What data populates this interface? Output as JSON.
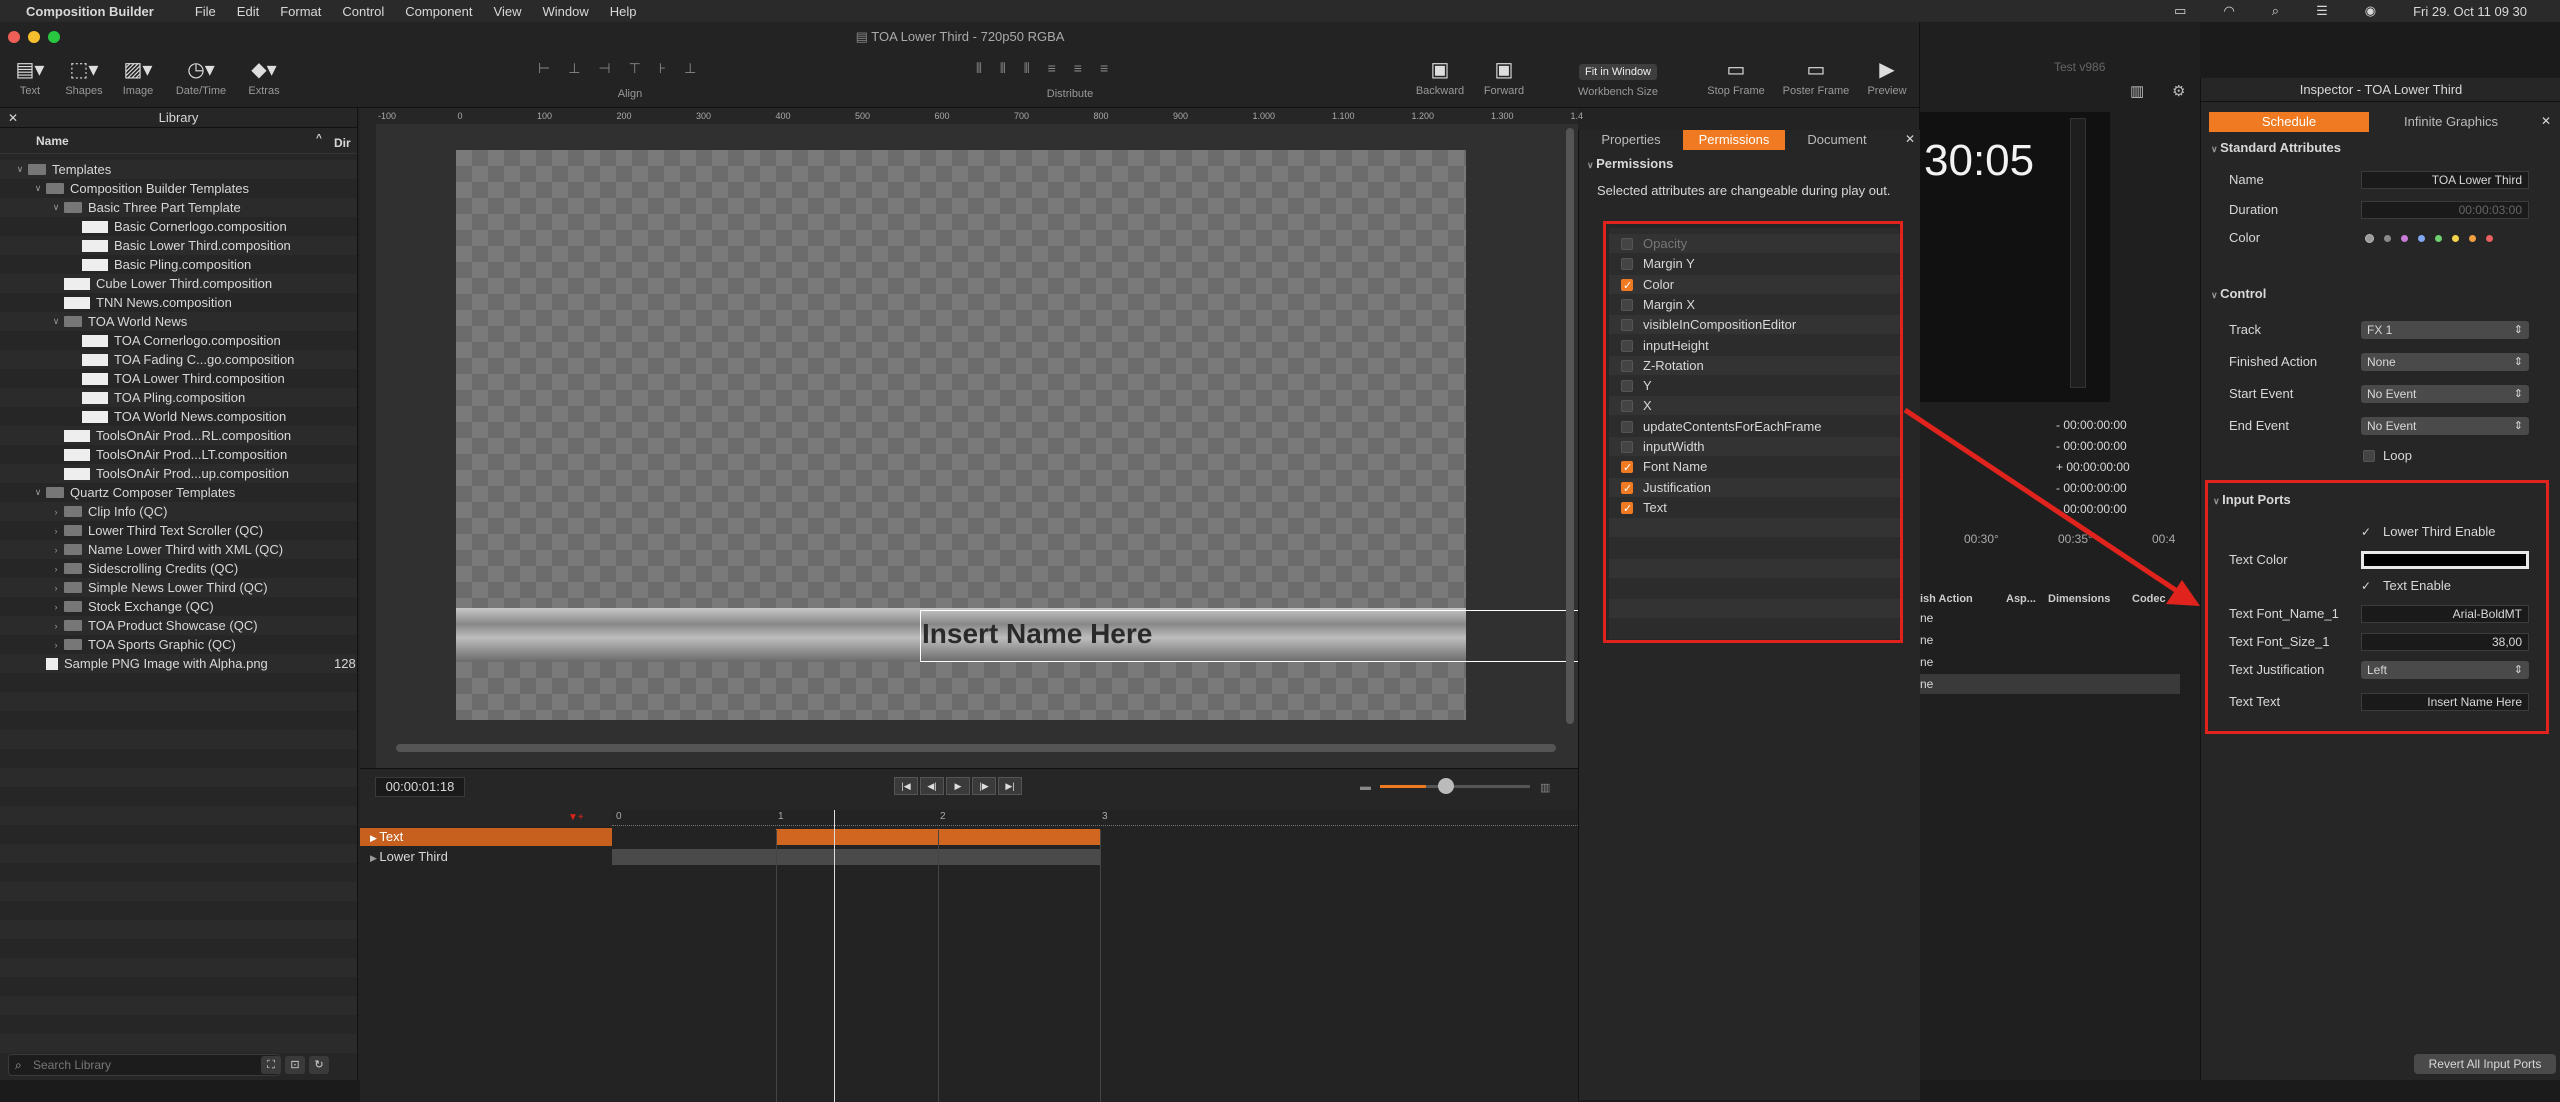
{
  "menubar": {
    "app": "Composition Builder",
    "items": [
      "File",
      "Edit",
      "Format",
      "Control",
      "Component",
      "View",
      "Window",
      "Help"
    ],
    "clock": "Fri 29. Oct  11 09 30"
  },
  "window": {
    "title": "TOA Lower Third - 720p50 RGBA"
  },
  "toolbar": {
    "text": "Text",
    "shapes": "Shapes",
    "image": "Image",
    "datetime": "Date/Time",
    "extras": "Extras",
    "align": "Align",
    "distribute": "Distribute",
    "backward": "Backward",
    "forward": "Forward",
    "workbench_value": "Fit in Window",
    "workbench_label": "Workbench Size",
    "stop_frame": "Stop Frame",
    "poster_frame": "Poster Frame",
    "preview": "Preview"
  },
  "library": {
    "title": "Library",
    "col_name": "Name",
    "col_dir": "Dir",
    "search_placeholder": "Search Library",
    "items": [
      {
        "label": "Templates",
        "depth": 0,
        "kind": "folder",
        "open": true
      },
      {
        "label": "Composition Builder Templates",
        "depth": 1,
        "kind": "folder",
        "open": true
      },
      {
        "label": "Basic Three Part Template",
        "depth": 2,
        "kind": "folder",
        "open": true
      },
      {
        "label": "Basic Cornerlogo.composition",
        "depth": 3,
        "kind": "file"
      },
      {
        "label": "Basic Lower Third.composition",
        "depth": 3,
        "kind": "file"
      },
      {
        "label": "Basic Pling.composition",
        "depth": 3,
        "kind": "file"
      },
      {
        "label": "Cube Lower Third.composition",
        "depth": 2,
        "kind": "file"
      },
      {
        "label": "TNN News.composition",
        "depth": 2,
        "kind": "file"
      },
      {
        "label": "TOA World News",
        "depth": 2,
        "kind": "folder",
        "open": true
      },
      {
        "label": "TOA Cornerlogo.composition",
        "depth": 3,
        "kind": "file"
      },
      {
        "label": "TOA Fading C...go.composition",
        "depth": 3,
        "kind": "file"
      },
      {
        "label": "TOA Lower Third.composition",
        "depth": 3,
        "kind": "file"
      },
      {
        "label": "TOA Pling.composition",
        "depth": 3,
        "kind": "file"
      },
      {
        "label": "TOA World News.composition",
        "depth": 3,
        "kind": "file"
      },
      {
        "label": "ToolsOnAir Prod...RL.composition",
        "depth": 2,
        "kind": "file"
      },
      {
        "label": "ToolsOnAir Prod...LT.composition",
        "depth": 2,
        "kind": "file"
      },
      {
        "label": "ToolsOnAir Prod...up.composition",
        "depth": 2,
        "kind": "file"
      },
      {
        "label": "Quartz Composer Templates",
        "depth": 1,
        "kind": "folder",
        "open": true
      },
      {
        "label": "Clip Info (QC)",
        "depth": 2,
        "kind": "folder"
      },
      {
        "label": "Lower Third Text Scroller (QC)",
        "depth": 2,
        "kind": "folder"
      },
      {
        "label": "Name Lower Third with XML (QC)",
        "depth": 2,
        "kind": "folder"
      },
      {
        "label": "Sidescrolling Credits (QC)",
        "depth": 2,
        "kind": "folder"
      },
      {
        "label": "Simple News Lower Third (QC)",
        "depth": 2,
        "kind": "folder"
      },
      {
        "label": "Stock Exchange (QC)",
        "depth": 2,
        "kind": "folder"
      },
      {
        "label": "TOA Product Showcase (QC)",
        "depth": 2,
        "kind": "folder"
      },
      {
        "label": "TOA Sports Graphic (QC)",
        "depth": 2,
        "kind": "folder"
      },
      {
        "label": "Sample PNG Image with Alpha.png",
        "depth": 1,
        "kind": "png",
        "extra": "128"
      }
    ]
  },
  "canvas": {
    "ruler": [
      "-100",
      "0",
      "100",
      "200",
      "300",
      "400",
      "500",
      "600",
      "700",
      "800",
      "900",
      "1.000",
      "1.100",
      "1.200",
      "1.300",
      "1.4"
    ],
    "name_text": "Insert Name Here"
  },
  "transport": {
    "timecode": "00:00:01:18"
  },
  "timeline": {
    "marks": [
      "0",
      "1",
      "2",
      "3"
    ],
    "tracks": [
      "Text",
      "Lower Third"
    ]
  },
  "right_panel": {
    "tabs": [
      "Properties",
      "Permissions",
      "Document"
    ],
    "section": "Permissions",
    "description": "Selected attributes are changeable during play out.",
    "attributes": [
      {
        "name": "Opacity",
        "checked": false,
        "disabled": true
      },
      {
        "name": "Margin Y",
        "checked": false
      },
      {
        "name": "Color",
        "checked": true
      },
      {
        "name": "Margin X",
        "checked": false
      },
      {
        "name": "visibleInCompositionEditor",
        "checked": false
      },
      {
        "name": "inputHeight",
        "checked": false
      },
      {
        "name": "Z-Rotation",
        "checked": false
      },
      {
        "name": "Y",
        "checked": false
      },
      {
        "name": "X",
        "checked": false
      },
      {
        "name": "updateContentsForEachFrame",
        "checked": false
      },
      {
        "name": "inputWidth",
        "checked": false
      },
      {
        "name": "Font Name",
        "checked": true
      },
      {
        "name": "Justification",
        "checked": true
      },
      {
        "name": "Text",
        "checked": true
      }
    ]
  },
  "background_app": {
    "title": "Test v986",
    "clock": "30:05",
    "timecodes": [
      "- 00:00:00:00",
      "- 00:00:00:00",
      "+ 00:00:00:00",
      "- 00:00:00:00",
      "- 00:00:00:00"
    ],
    "ruler": [
      "00:30°",
      "00:35°",
      "00:4"
    ],
    "cols": [
      "ish Action",
      "Asp...",
      "Dimensions",
      "Codec"
    ],
    "rows": [
      "ne",
      "ne",
      "ne",
      "ne"
    ]
  },
  "inspector": {
    "title": "Inspector - TOA Lower Third",
    "tabs": [
      "Schedule",
      "Infinite Graphics"
    ],
    "standard": "Standard Attributes",
    "name_label": "Name",
    "name_value": "TOA Lower Third",
    "duration_label": "Duration",
    "duration_value": "00:00:03:00",
    "color_label": "Color",
    "control": "Control",
    "track_label": "Track",
    "track_value": "FX 1",
    "finished_label": "Finished Action",
    "finished_value": "None",
    "start_label": "Start Event",
    "start_value": "No Event",
    "end_label": "End Event",
    "end_value": "No Event",
    "loop_label": "Loop",
    "ports": "Input Ports",
    "lower_enable": "Lower Third Enable",
    "text_color": "Text Color",
    "text_enable": "Text Enable",
    "font_name_label": "Text Font_Name_1",
    "font_name_value": "Arial-BoldMT",
    "font_size_label": "Text Font_Size_1",
    "font_size_value": "38,00",
    "justification_label": "Text Justification",
    "justification_value": "Left",
    "text_label": "Text Text",
    "text_value": "Insert Name Here",
    "revert": "Revert All Input Ports",
    "dot_colors": [
      "#9a9a9a",
      "#8a8a8a",
      "#c77cd8",
      "#7fa7f0",
      "#6fd06f",
      "#f2d34a",
      "#f0a040",
      "#e86060"
    ]
  },
  "accent": "#f07a22",
  "annotation": "#e0231c"
}
